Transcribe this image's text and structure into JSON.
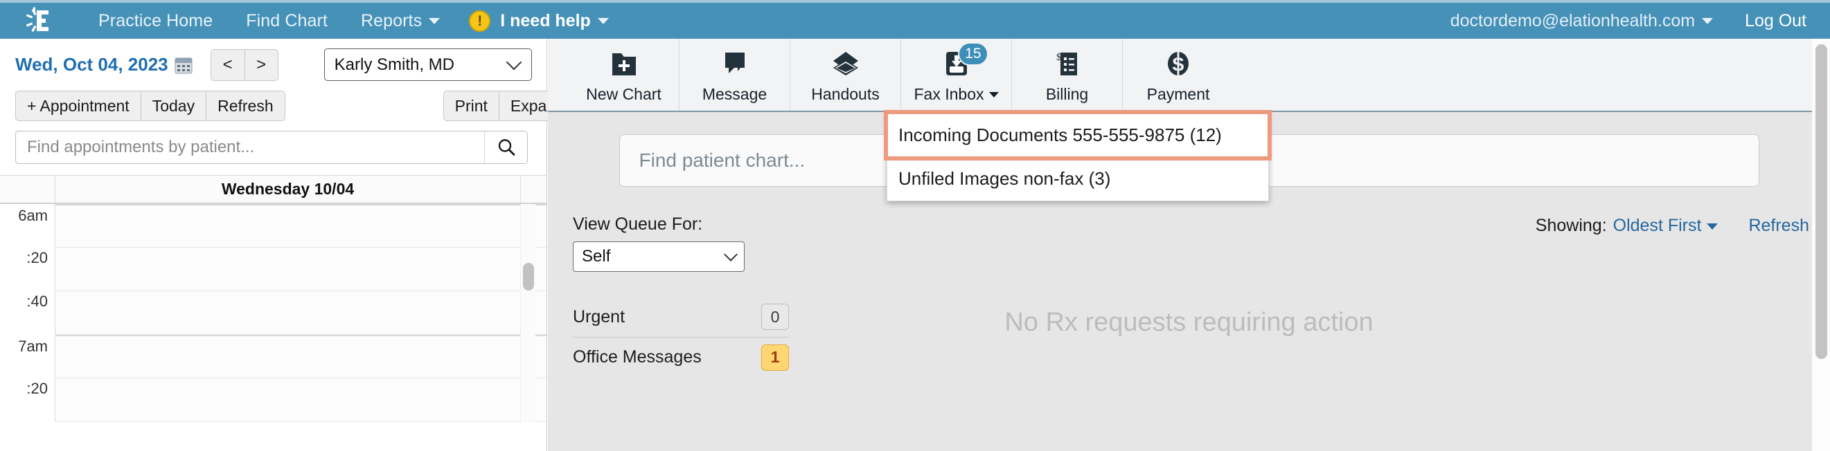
{
  "topnav": {
    "logo_icon": "elation-starburst-e-logo",
    "links": [
      {
        "label": "Practice Home",
        "has_caret": false
      },
      {
        "label": "Find Chart",
        "has_caret": false
      },
      {
        "label": "Reports",
        "has_caret": true
      }
    ],
    "help": {
      "icon": "alert-exclamation-icon",
      "glyph": "!",
      "label": "I need help",
      "has_caret": true
    },
    "user_email": "doctordemo@elationhealth.com",
    "logout_label": "Log Out",
    "bar_color": "#4591b8"
  },
  "calendar": {
    "date_label": "Wed, Oct 04, 2023",
    "calendar_icon": "calendar-icon",
    "prev_label": "<",
    "next_label": ">",
    "provider": "Karly Smith, MD",
    "buttons": {
      "appointment": "+ Appointment",
      "today": "Today",
      "refresh": "Refresh",
      "print": "Print",
      "expand": "Expand"
    },
    "search_placeholder": "Find appointments by patient...",
    "search_value": "",
    "search_icon": "search-icon",
    "day_header": "Wednesday 10/04",
    "slots": [
      {
        "label": "6am",
        "hour": true
      },
      {
        "label": ":20",
        "hour": false
      },
      {
        "label": ":40",
        "hour": false
      },
      {
        "label": "7am",
        "hour": true
      },
      {
        "label": ":20",
        "hour": false
      }
    ]
  },
  "toolbar": {
    "items": [
      {
        "label": "New Chart",
        "icon": "new-chart-folder-plus-icon",
        "badge": null,
        "caret": false
      },
      {
        "label": "Message",
        "icon": "message-bubble-icon",
        "badge": null,
        "caret": false
      },
      {
        "label": "Handouts",
        "icon": "handouts-stack-icon",
        "badge": null,
        "caret": false
      },
      {
        "label": "Fax Inbox",
        "icon": "fax-inbox-download-icon",
        "badge": "15",
        "caret": true
      },
      {
        "label": "Billing",
        "icon": "billing-invoice-icon",
        "badge": null,
        "caret": false
      },
      {
        "label": "Payment",
        "icon": "payment-dollar-circle-icon",
        "badge": null,
        "caret": false
      }
    ],
    "badge_color": "#3d8fba"
  },
  "fax_dropdown": {
    "open": true,
    "highlight_color": "#ee9a7e",
    "items": [
      {
        "label": "Incoming Documents 555-555-9875 (12)",
        "highlighted": true
      },
      {
        "label": "Unfiled Images non-fax (3)",
        "highlighted": false
      }
    ]
  },
  "main": {
    "chart_search_placeholder": "Find patient chart...",
    "chart_search_value": "",
    "queue_label": "View Queue For:",
    "queue_value": "Self",
    "counters": [
      {
        "name": "Urgent",
        "count": "0",
        "style": "grey"
      },
      {
        "name": "Office Messages",
        "count": "1",
        "style": "amber"
      }
    ],
    "empty_message": "No Rx requests requiring action",
    "showing_label": "Showing:",
    "showing_value": "Oldest First",
    "refresh_label": "Refresh",
    "link_color": "#25679e"
  }
}
